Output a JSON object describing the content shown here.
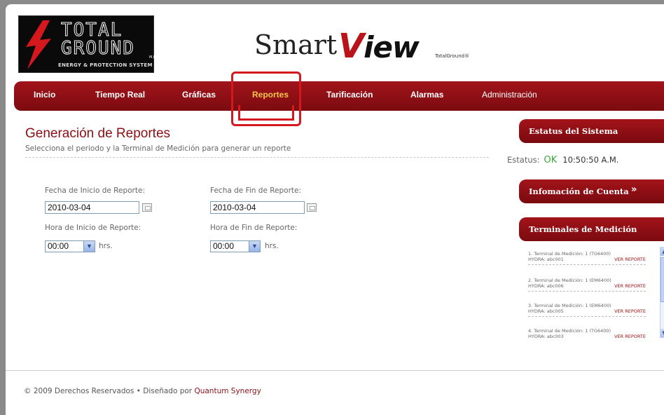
{
  "logo": {
    "line1": "TOTAL",
    "line2": "GROUND",
    "mark": "M.R",
    "tagline": "ENERGY & PROTECTION SYSTEM"
  },
  "brand": {
    "smart": "Smart",
    "view_v": "V",
    "view_rest": "iew",
    "small": "TotalGround®"
  },
  "nav": [
    {
      "label": "Inicio"
    },
    {
      "label": "Tiempo Real"
    },
    {
      "label": "Gráficas"
    },
    {
      "label": "Reportes"
    },
    {
      "label": "Tarificación"
    },
    {
      "label": "Alarmas"
    },
    {
      "label": "Administración"
    }
  ],
  "nav_active": "Reportes",
  "main": {
    "title": "Generación de Reportes",
    "subtitle": "Selecciona el periodo y la Terminal de Medición para generar un reporte",
    "start_date_label": "Fecha de Inicio de Reporte:",
    "start_date_value": "2010-03-04",
    "end_date_label": "Fecha de Fin de Reporte:",
    "end_date_value": "2010-03-04",
    "start_time_label": "Hora de Inicio de Reporte:",
    "start_time_value": "00:00",
    "end_time_label": "Hora de Fin de Reporte:",
    "end_time_value": "00:00",
    "hrs": "hrs."
  },
  "sidebar": {
    "status_title": "Estatus del Sistema",
    "status_label": "Estatus:",
    "status_value": "OK",
    "status_time": "10:50:50 A.M.",
    "account_title": "Infomación de Cuenta",
    "terminals_title": "Terminales de Medición",
    "terminals": [
      {
        "line1": "1. Terminal de Medición: 1 (TG6400)",
        "line2": "HYDRA: abc001",
        "link": "VER REPORTE"
      },
      {
        "line1": "2. Terminal de Medición: 1 (EM6400)",
        "line2": "HYDRA: abc006",
        "link": "VER REPORTE"
      },
      {
        "line1": "3. Terminal de Medición: 1 (EM6400)",
        "line2": "HYDRA: abc005",
        "link": "VER REPORTE"
      },
      {
        "line1": "4. Terminal de Medición: 1 (TG6400)",
        "line2": "HYDRA: abc003",
        "link": "VER REPORTE"
      }
    ]
  },
  "footer": {
    "copyright": "©  2009 Derechos Reservados  •  Diseñado por ",
    "designer": "Quantum Synergy"
  },
  "colors": {
    "brand_red": "#8a1015",
    "nav_active": "#f6c64a",
    "status_ok": "#3aa63a",
    "highlight": "#d4181e"
  }
}
